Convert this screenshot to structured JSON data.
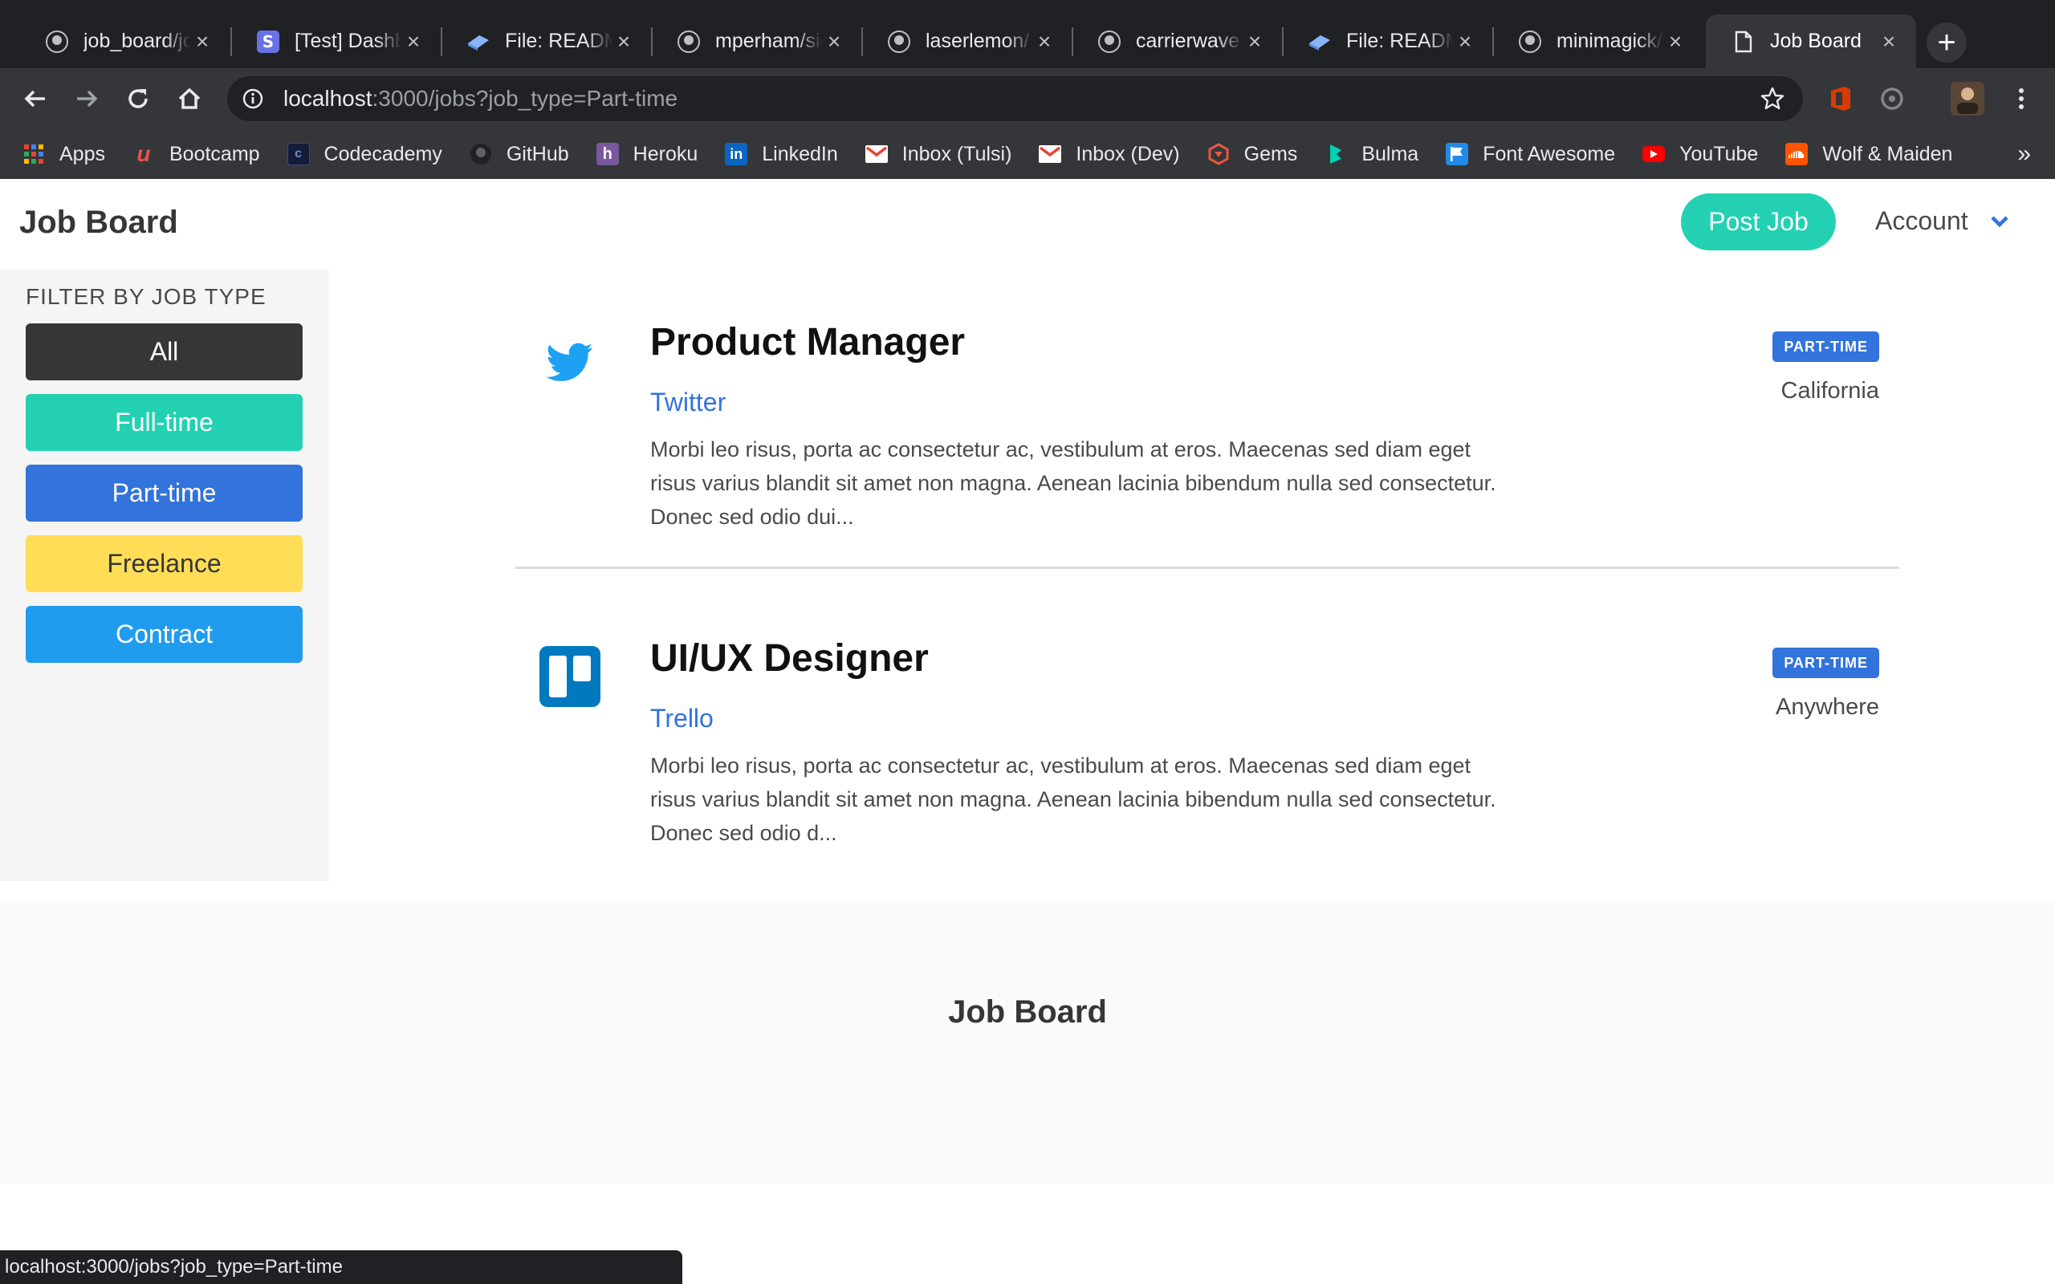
{
  "browser": {
    "tabs": [
      {
        "title": "job_board/jo",
        "icon": "github-icon"
      },
      {
        "title": "[Test] Dashb",
        "icon": "stripe-icon"
      },
      {
        "title": "File: README",
        "icon": "rdoc-icon"
      },
      {
        "title": "mperham/sid",
        "icon": "github-icon"
      },
      {
        "title": "laserlemon/",
        "icon": "github-icon"
      },
      {
        "title": "carrierwave",
        "icon": "github-icon"
      },
      {
        "title": "File: README",
        "icon": "rdoc-icon"
      },
      {
        "title": "minimagick/",
        "icon": "github-icon"
      },
      {
        "title": "Job Board",
        "icon": "page-icon",
        "active": true
      }
    ],
    "url_host": "localhost",
    "url_rest": ":3000/jobs?job_type=Part-time",
    "bookmarks": [
      {
        "label": "Apps",
        "icon": "apps-grid-icon"
      },
      {
        "label": "Bootcamp",
        "icon": "bootcamp-icon"
      },
      {
        "label": "Codecademy",
        "icon": "codecademy-icon"
      },
      {
        "label": "GitHub",
        "icon": "github-icon"
      },
      {
        "label": "Heroku",
        "icon": "heroku-icon"
      },
      {
        "label": "LinkedIn",
        "icon": "linkedin-icon"
      },
      {
        "label": "Inbox (Tulsi)",
        "icon": "gmail-icon"
      },
      {
        "label": "Inbox (Dev)",
        "icon": "gmail-icon"
      },
      {
        "label": "Gems",
        "icon": "rubygems-icon"
      },
      {
        "label": "Bulma",
        "icon": "bulma-icon"
      },
      {
        "label": "Font Awesome",
        "icon": "font-awesome-icon"
      },
      {
        "label": "YouTube",
        "icon": "youtube-icon"
      },
      {
        "label": "Wolf & Maiden",
        "icon": "soundcloud-icon"
      }
    ],
    "bookmarks_more": "»",
    "status_url": "localhost:3000/jobs?job_type=Part-time"
  },
  "navbar": {
    "brand": "Job Board",
    "post_job": "Post Job",
    "account": "Account"
  },
  "sidebar": {
    "heading": "FILTER BY JOB TYPE",
    "filters": [
      {
        "label": "All",
        "color": "#363636",
        "text_color": "#ffffff"
      },
      {
        "label": "Full-time",
        "color": "#23d1b2",
        "text_color": "#ffffff"
      },
      {
        "label": "Part-time",
        "color": "#3273dc",
        "text_color": "#ffffff"
      },
      {
        "label": "Freelance",
        "color": "#ffdd57",
        "text_color": "#363636"
      },
      {
        "label": "Contract",
        "color": "#209cee",
        "text_color": "#ffffff"
      }
    ]
  },
  "jobs": [
    {
      "title": "Product Manager",
      "company": "Twitter",
      "logo": "twitter-icon",
      "description": "Morbi leo risus, porta ac consectetur ac, vestibulum at eros. Maecenas sed diam eget risus varius blandit sit amet non magna. Aenean lacinia bibendum nulla sed consectetur. Donec sed odio dui...",
      "tag": "PART-TIME",
      "location": "California"
    },
    {
      "title": "UI/UX Designer",
      "company": "Trello",
      "logo": "trello-icon",
      "description": "Morbi leo risus, porta ac consectetur ac, vestibulum at eros. Maecenas sed diam eget risus varius blandit sit amet non magna. Aenean lacinia bibendum nulla sed consectetur. Donec sed odio d...",
      "tag": "PART-TIME",
      "location": "Anywhere"
    }
  ],
  "footer": {
    "title": "Job Board"
  },
  "colors": {
    "primary": "#23d1b2",
    "link": "#3273dc",
    "twitter": "#1da1f2",
    "trello": "#0079bf"
  }
}
